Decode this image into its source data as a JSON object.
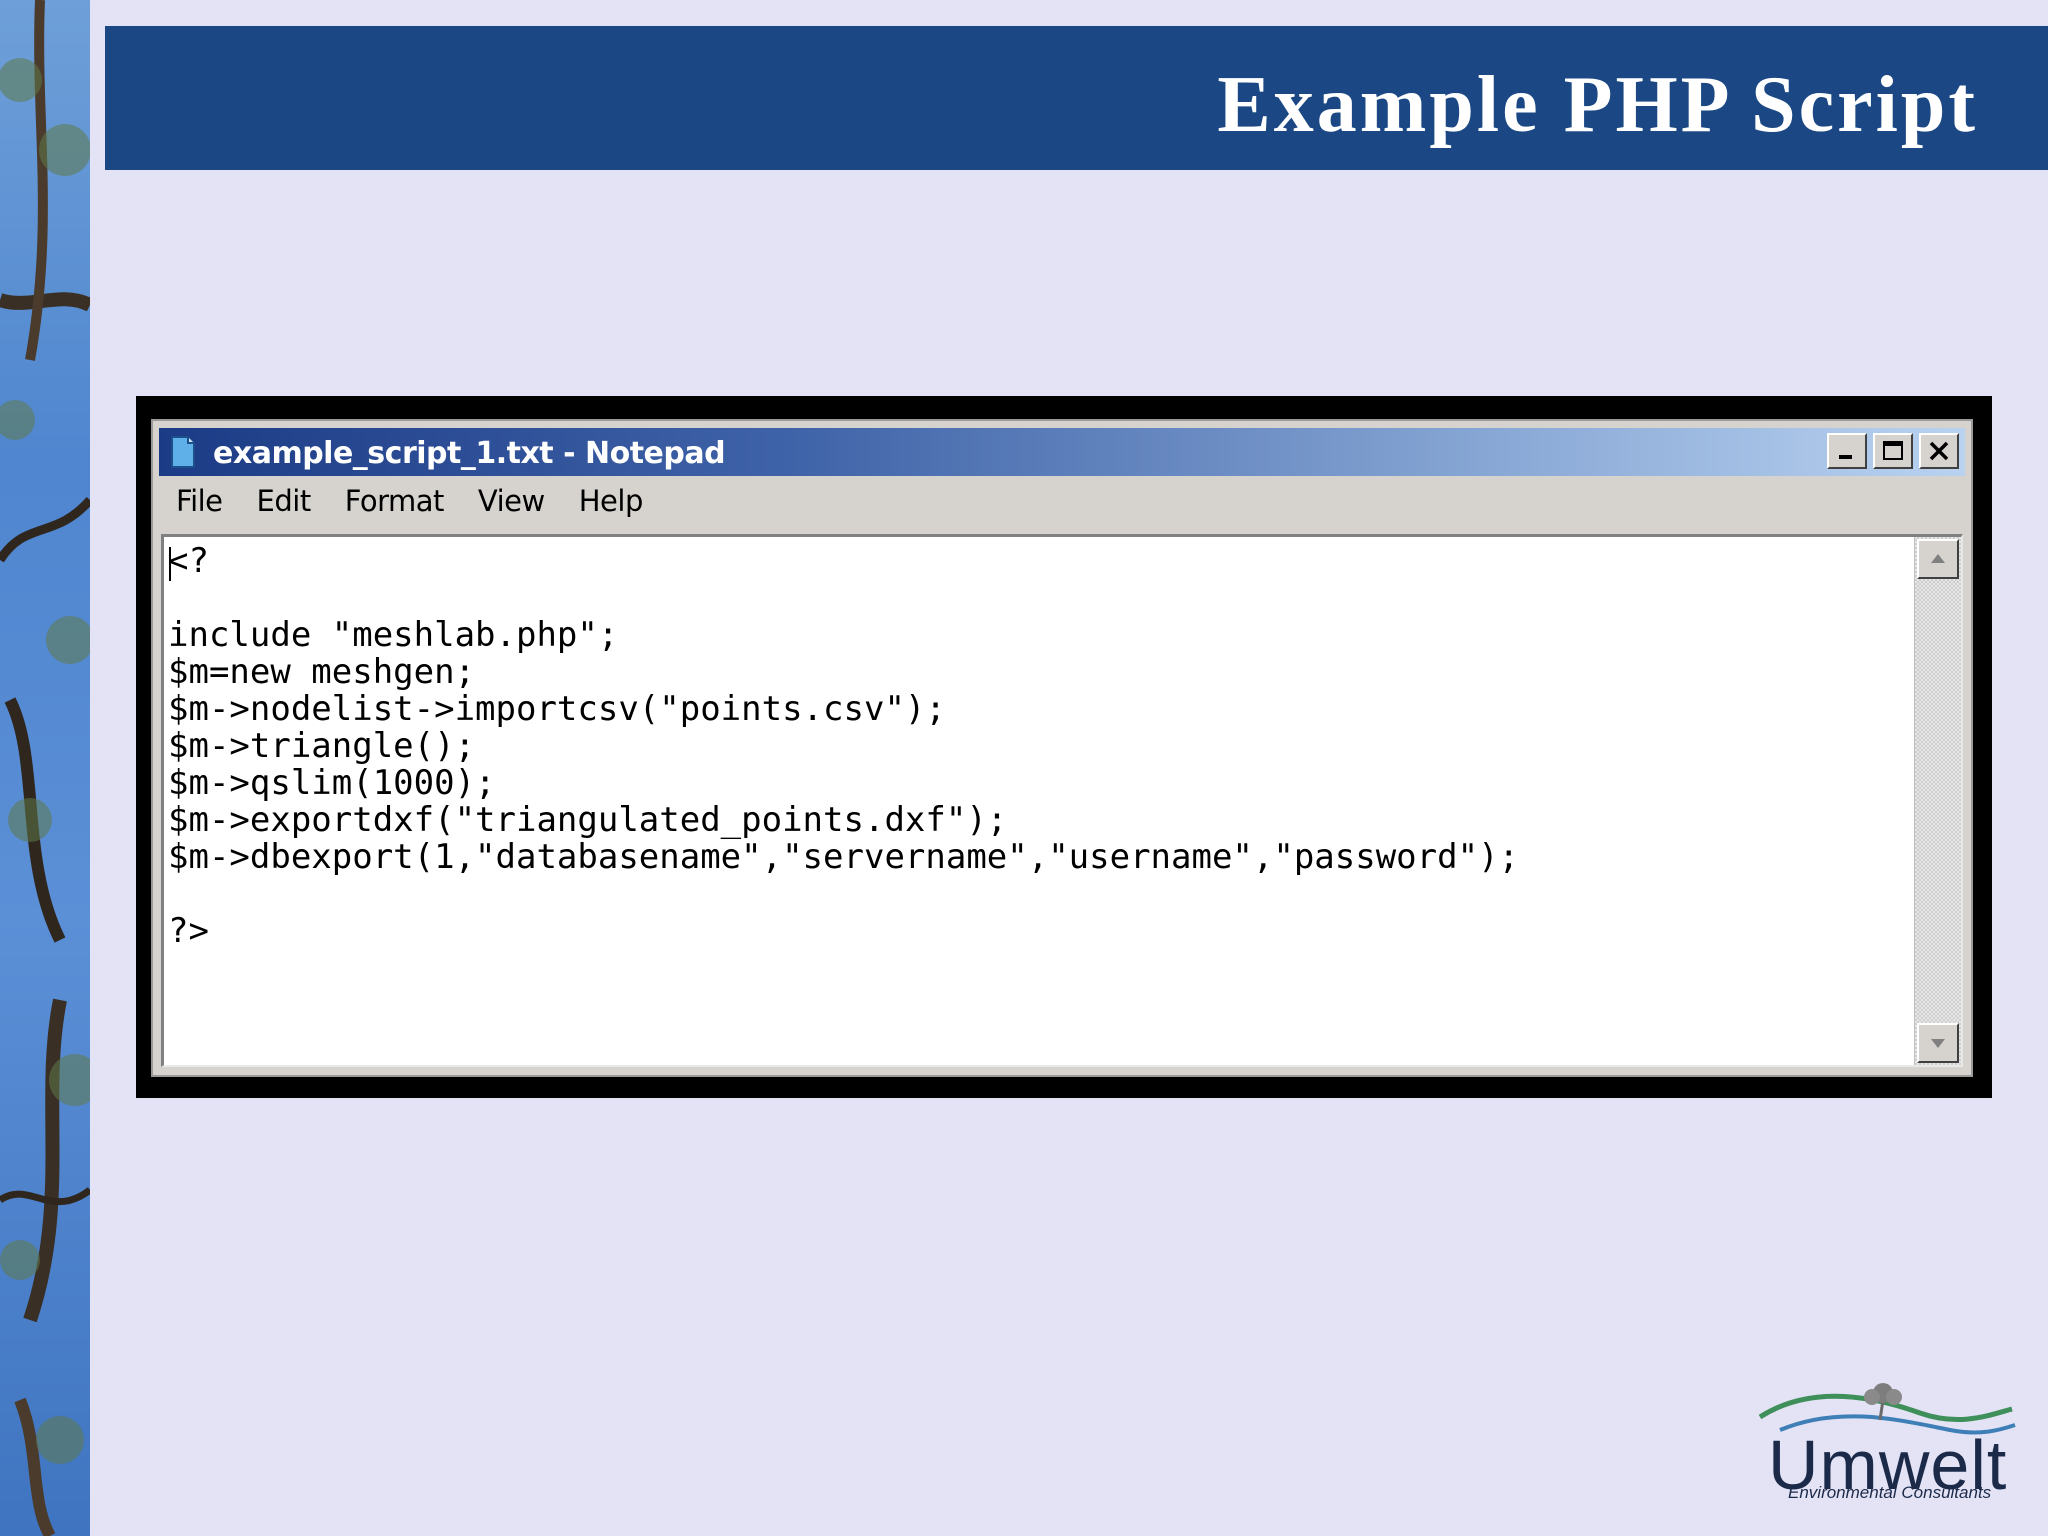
{
  "slide": {
    "title": "Example PHP Script"
  },
  "notepad": {
    "window_title": "example_script_1.txt - Notepad",
    "menu": [
      "File",
      "Edit",
      "Format",
      "View",
      "Help"
    ],
    "code_lines": [
      "<?",
      "",
      "include \"meshlab.php\";",
      "$m=new meshgen;",
      "$m->nodelist->importcsv(\"points.csv\");",
      "$m->triangle();",
      "$m->qslim(1000);",
      "$m->exportdxf(\"triangulated_points.dxf\");",
      "$m->dbexport(1,\"databasename\",\"servername\",\"username\",\"password\");",
      "",
      "?>"
    ],
    "icons": {
      "app": "notepad-file-icon",
      "minimize": "minimize-icon",
      "maximize": "maximize-icon",
      "close": "close-icon",
      "scroll_up": "scroll-up-arrow-icon",
      "scroll_down": "scroll-down-arrow-icon"
    }
  },
  "logo": {
    "wordmark": "Umwelt",
    "tagline": "Environmental Consultants"
  },
  "colors": {
    "slide_background": "#e3e3f5",
    "title_bar": "#1b4884",
    "notepad_title_gradient_start": "#1c3b86",
    "notepad_title_gradient_end": "#b9d2f0"
  }
}
